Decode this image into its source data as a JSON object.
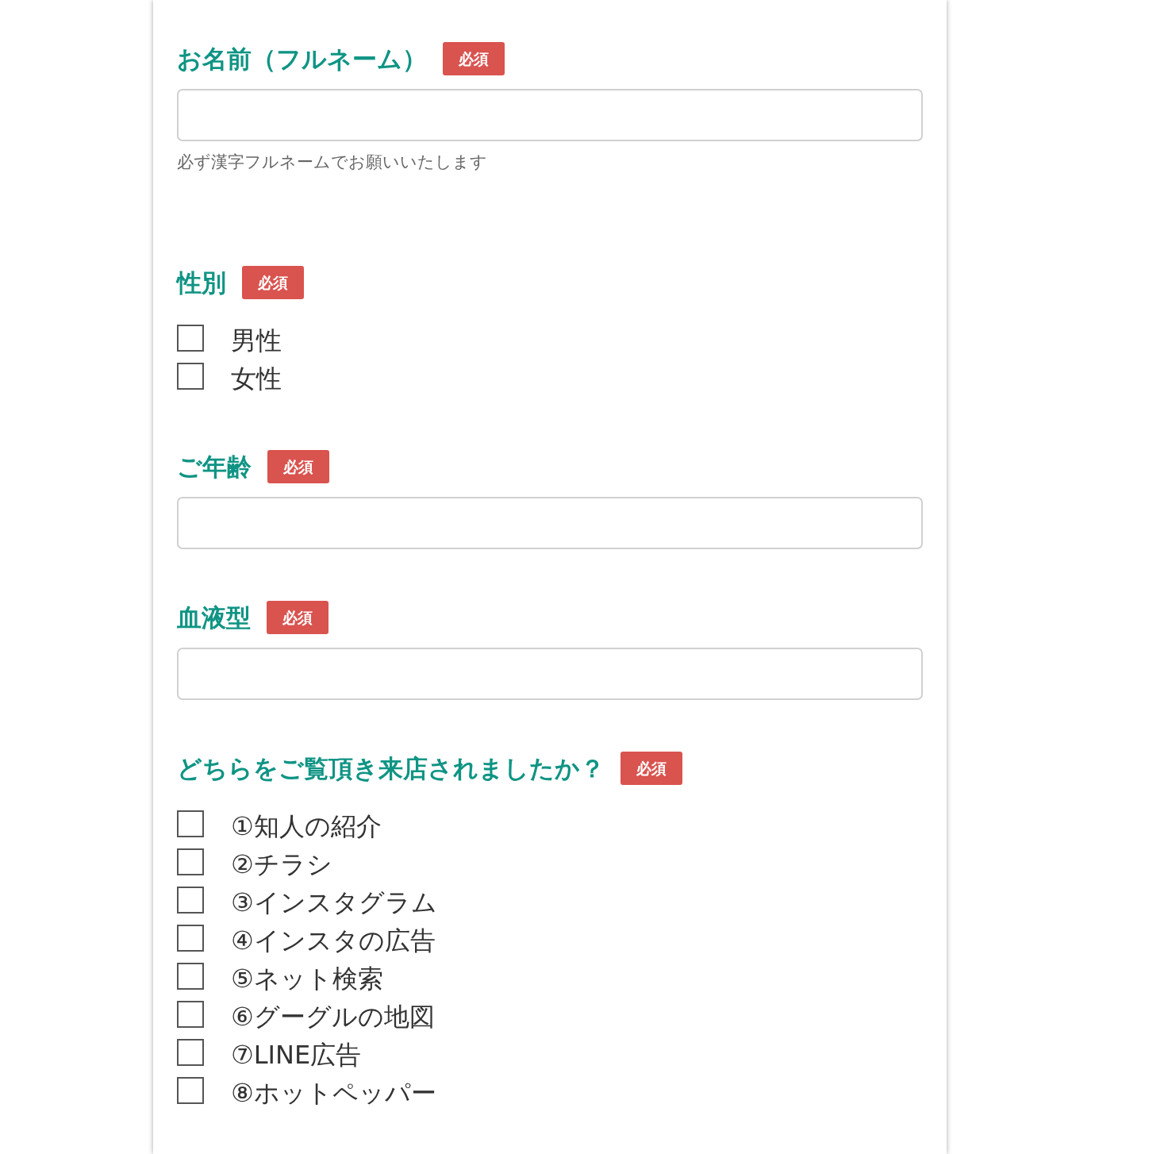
{
  "fields": [
    {
      "kind": "text",
      "label": "お名前（フルネーム）",
      "badge": "必須",
      "hint": "必ず漢字フルネームでお願いいたします"
    },
    {
      "kind": "checkboxes",
      "label": "性別",
      "badge": "必須",
      "options": [
        {
          "label": "男性",
          "checked": false
        },
        {
          "label": "女性",
          "checked": false
        }
      ]
    },
    {
      "kind": "text",
      "label": "ご年齢",
      "badge": "必須"
    },
    {
      "kind": "text",
      "label": "血液型",
      "badge": "必須"
    },
    {
      "kind": "checkboxes",
      "label": "どちらをご覧頂き来店されましたか？",
      "badge": "必須",
      "options": [
        {
          "label": "①知人の紹介",
          "checked": false
        },
        {
          "label": "②チラシ",
          "checked": false
        },
        {
          "label": "③インスタグラム",
          "checked": false
        },
        {
          "label": "④インスタの広告",
          "checked": false
        },
        {
          "label": "⑤ネット検索",
          "checked": false
        },
        {
          "label": "⑥グーグルの地図",
          "checked": false
        },
        {
          "label": "⑦LINE広告",
          "checked": false
        },
        {
          "label": "⑧ホットペッパー",
          "checked": false
        }
      ]
    }
  ]
}
